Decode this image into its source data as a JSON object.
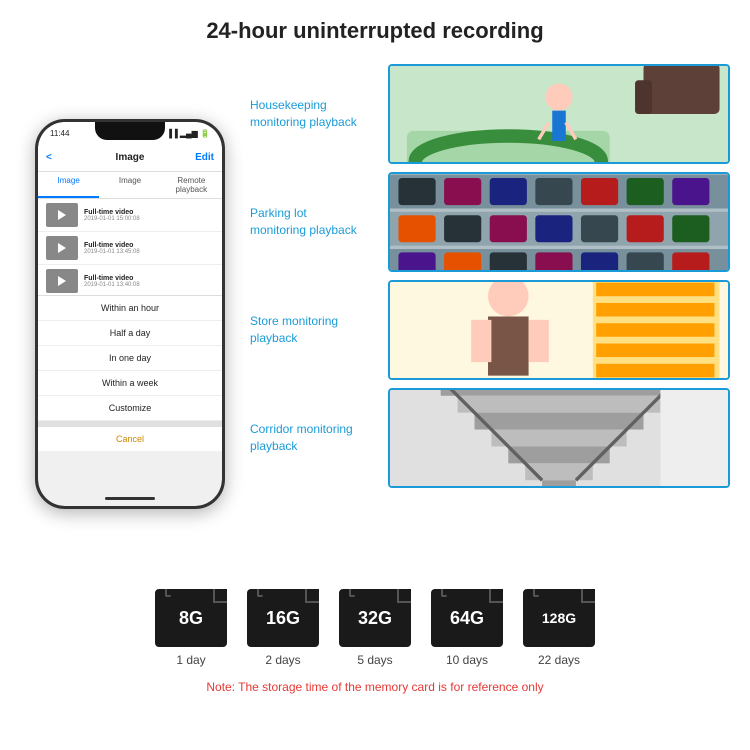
{
  "header": {
    "title": "24-hour uninterrupted recording"
  },
  "phone": {
    "status_time": "11:44",
    "nav_title": "Image",
    "nav_back": "<",
    "nav_edit": "Edit",
    "tabs": [
      "Image",
      "Image",
      "Remote playback"
    ],
    "videos": [
      {
        "title": "Full-time video",
        "date": "2019-01-01 15:00:08"
      },
      {
        "title": "Full-time video",
        "date": "2019-01-01 13:45:08"
      },
      {
        "title": "Full-time video",
        "date": "2019-01-01 13:40:08"
      }
    ],
    "dropdown_items": [
      "Within an hour",
      "Half a day",
      "In one day",
      "Within a week",
      "Customize"
    ],
    "cancel_label": "Cancel"
  },
  "monitoring": [
    {
      "label": "Housekeeping\nmonitoring playback",
      "image_type": "housekeeping"
    },
    {
      "label": "Parking lot\nmonitoring playback",
      "image_type": "parking"
    },
    {
      "label": "Store monitoring\nplayback",
      "image_type": "store"
    },
    {
      "label": "Corridor monitoring\nplayback",
      "image_type": "corridor"
    }
  ],
  "storage": [
    {
      "capacity": "8G",
      "days": "1 day"
    },
    {
      "capacity": "16G",
      "days": "2 days"
    },
    {
      "capacity": "32G",
      "days": "5 days"
    },
    {
      "capacity": "64G",
      "days": "10 days"
    },
    {
      "capacity": "128G",
      "days": "22 days"
    }
  ],
  "note": "Note: The storage time of the memory card is for reference only",
  "colors": {
    "accent_blue": "#1a9bd8",
    "card_bg": "#1a1a1a",
    "note_red": "#e53935"
  }
}
